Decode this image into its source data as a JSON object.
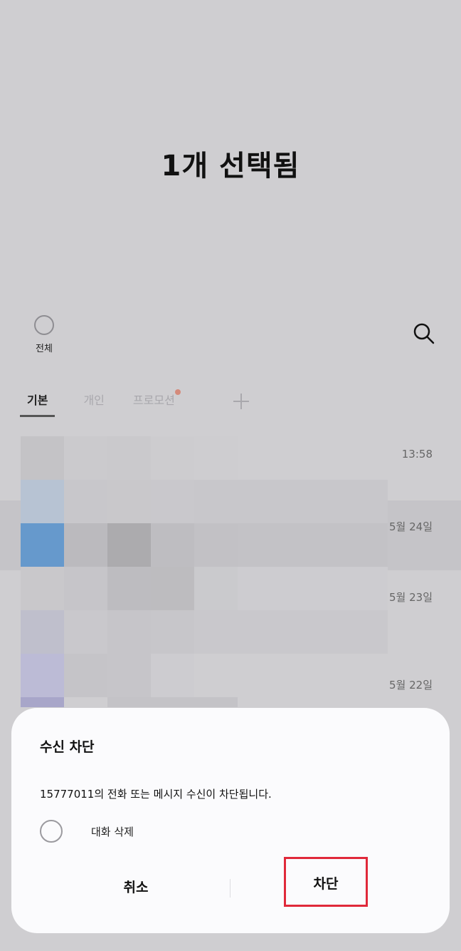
{
  "header": {
    "title": "1개 선택됨"
  },
  "toolbar": {
    "select_all_label": "전체",
    "search_icon": "search-icon"
  },
  "tabs": [
    {
      "label": "기본",
      "active": true
    },
    {
      "label": "개인",
      "active": false
    },
    {
      "label": "프로모션",
      "active": false,
      "has_badge": true
    }
  ],
  "add_tab_icon": "plus-icon",
  "conversations": [
    {
      "time": "13:58"
    },
    {
      "time": "5월 24일"
    },
    {
      "time": "5월 23일"
    },
    {
      "time": "5월 22일"
    }
  ],
  "dialog": {
    "title": "수신 차단",
    "message": "15777011의 전화 또는 메시지 수신이 차단됩니다.",
    "checkbox_label": "대화 삭제",
    "checkbox_checked": false,
    "cancel_label": "취소",
    "block_label": "차단"
  },
  "colors": {
    "highlight_box": "#e0293a",
    "badge_dot": "#d48a7b",
    "background": "#cfced1",
    "dialog_background": "#fbfbfd"
  }
}
